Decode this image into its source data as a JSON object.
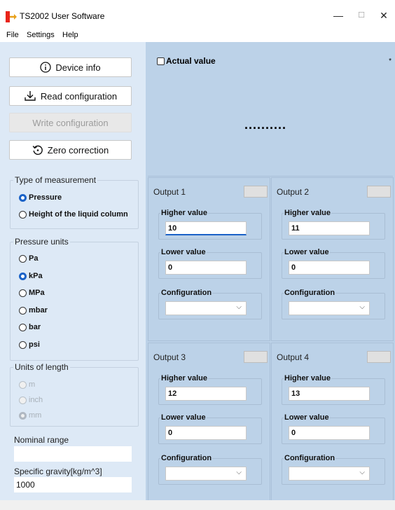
{
  "window": {
    "title": "TS2002 User Software",
    "controls": {
      "minimize": "—",
      "maximize": "☐",
      "close": "✕"
    }
  },
  "menu": [
    "File",
    "Settings",
    "Help"
  ],
  "buttons": {
    "device_info": "Device info",
    "read_config": "Read configuration",
    "write_config": "Write configuration",
    "zero_correction": "Zero correction"
  },
  "measurement": {
    "title": "Type of measurement",
    "options": [
      "Pressure",
      "Height of the liquid column"
    ],
    "selected": "Pressure"
  },
  "pressure_units": {
    "title": "Pressure units",
    "options": [
      "Pa",
      "kPa",
      "MPa",
      "mbar",
      "bar",
      "psi"
    ],
    "selected": "kPa"
  },
  "length_units": {
    "title": "Units of length",
    "options": [
      "m",
      "inch",
      "mm"
    ],
    "selected": "mm",
    "enabled": false
  },
  "nominal_range": {
    "label": "Nominal range",
    "value": ""
  },
  "specific_gravity": {
    "label": "Specific gravity[kg/m^3]",
    "value": "1000"
  },
  "actual": {
    "checkbox_label": "Actual value",
    "display": "..........",
    "marker": "*"
  },
  "outputs": [
    {
      "title": "Output 1",
      "higher_label": "Higher value",
      "higher": "10",
      "lower_label": "Lower value",
      "lower": "0",
      "config_label": "Configuration",
      "config": ""
    },
    {
      "title": "Output 2",
      "higher_label": "Higher value",
      "higher": "11",
      "lower_label": "Lower value",
      "lower": "0",
      "config_label": "Configuration",
      "config": ""
    },
    {
      "title": "Output 3",
      "higher_label": "Higher value",
      "higher": "12",
      "lower_label": "Lower value",
      "lower": "0",
      "config_label": "Configuration",
      "config": ""
    },
    {
      "title": "Output 4",
      "higher_label": "Higher value",
      "higher": "13",
      "lower_label": "Lower value",
      "lower": "0",
      "config_label": "Configuration",
      "config": ""
    }
  ],
  "icons": {
    "app": "app-logo-icon",
    "device_info": "info-icon",
    "read_config": "download-icon",
    "zero_correction": "reset-icon",
    "select": "chevron-down-icon"
  },
  "colors": {
    "left_panel": "#dde9f6",
    "right_panel": "#bcd2e8",
    "radio_selected": "#1a62c7",
    "focus_underline": "#1a62c7",
    "indicator": "#e0e0e0"
  }
}
